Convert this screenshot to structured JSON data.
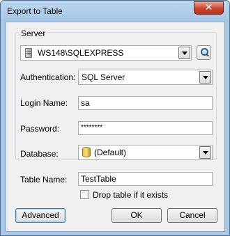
{
  "window": {
    "title": "Export to Table",
    "close_label": "✕"
  },
  "server_group": {
    "label": "Server",
    "server_value": "WS148\\SQLEXPRESS",
    "authentication_label": "Authentication:",
    "authentication_value": "SQL Server",
    "login_label": "Login Name:",
    "login_value": "sa",
    "password_label": "Password:",
    "password_value": "********"
  },
  "database_label": "Database:",
  "database_value": "(Default)",
  "table_name_label": "Table Name:",
  "table_name_value": "TestTable",
  "drop_table": {
    "label": "Drop table if it exists",
    "checked": false
  },
  "buttons": {
    "advanced": "Advanced",
    "ok": "OK",
    "cancel": "Cancel"
  }
}
